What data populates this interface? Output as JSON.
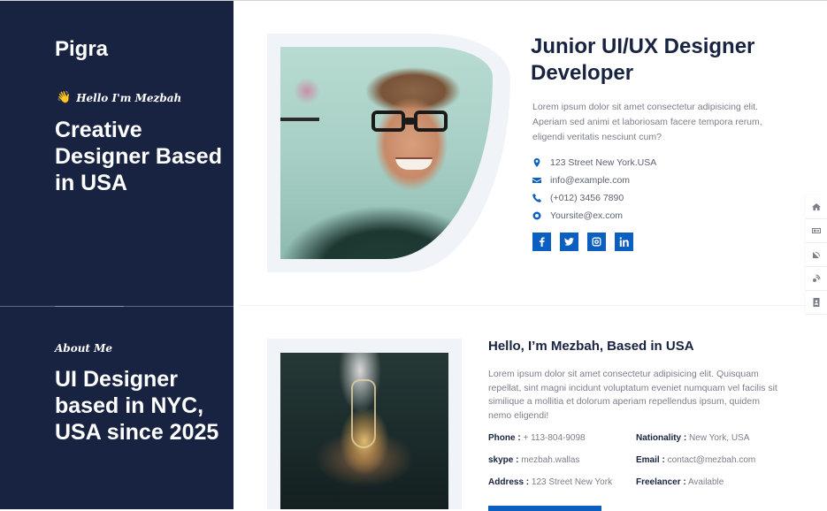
{
  "sidebar": {
    "brand": "Pigra",
    "greeting_emoji": "👋",
    "greeting": "Hello I'm Mezbah",
    "hero_title": "Creative Designer Based in USA",
    "about_kicker": "About Me",
    "about_title": "UI Designer based in NYC, USA since 2025"
  },
  "hero": {
    "job_title": "Junior UI/UX Designer Developer",
    "description": "Lorem ipsum dolor sit amet consectetur adipisicing elit. Aperiam sed animi et laboriosam facere tempora rerum, eligendi veritatis nesciunt cum?",
    "contacts": [
      {
        "icon": "map-marker-icon",
        "text": "123 Street New York.USA"
      },
      {
        "icon": "envelope-icon",
        "text": "info@example.com"
      },
      {
        "icon": "phone-icon",
        "text": "(+012) 3456 7890"
      },
      {
        "icon": "globe-icon",
        "text": "Yoursite@ex.com"
      }
    ],
    "socials": [
      {
        "icon": "facebook-icon",
        "label": "f"
      },
      {
        "icon": "twitter-icon",
        "label": "t"
      },
      {
        "icon": "instagram-icon",
        "label": "ig"
      },
      {
        "icon": "linkedin-icon",
        "label": "in"
      }
    ]
  },
  "floating_nav": [
    {
      "icon": "home-icon",
      "label": "Home"
    },
    {
      "icon": "id-card-icon",
      "label": "About"
    },
    {
      "icon": "satellite-dish-icon",
      "label": "Services"
    },
    {
      "icon": "wifi-signal-icon",
      "label": "Blog"
    },
    {
      "icon": "contact-book-icon",
      "label": "Contact"
    }
  ],
  "about": {
    "heading": "Hello, I’m Mezbah, Based in USA",
    "description": "Lorem ipsum dolor sit amet consectetur adipisicing elit. Quisquam repellat, sint magni incidunt voluptatum eveniet numquam vel facilis sit similique a mollitia et dolorum aperiam repellendus ipsum, quidem nemo eligendi!",
    "info": [
      {
        "label": "Phone :",
        "value": "+ 113-804-9098"
      },
      {
        "label": "Nationality :",
        "value": "New York, USA"
      },
      {
        "label": "skype :",
        "value": "mezbah.wallas"
      },
      {
        "label": "Email :",
        "value": "contact@mezbah.com"
      },
      {
        "label": "Address :",
        "value": "123 Street New York"
      },
      {
        "label": "Freelancer :",
        "value": "Available"
      }
    ]
  },
  "colors": {
    "sidebar_bg": "#172341",
    "accent": "#0b5fc0",
    "heading": "#172341",
    "body_text": "#7a7f8a"
  }
}
